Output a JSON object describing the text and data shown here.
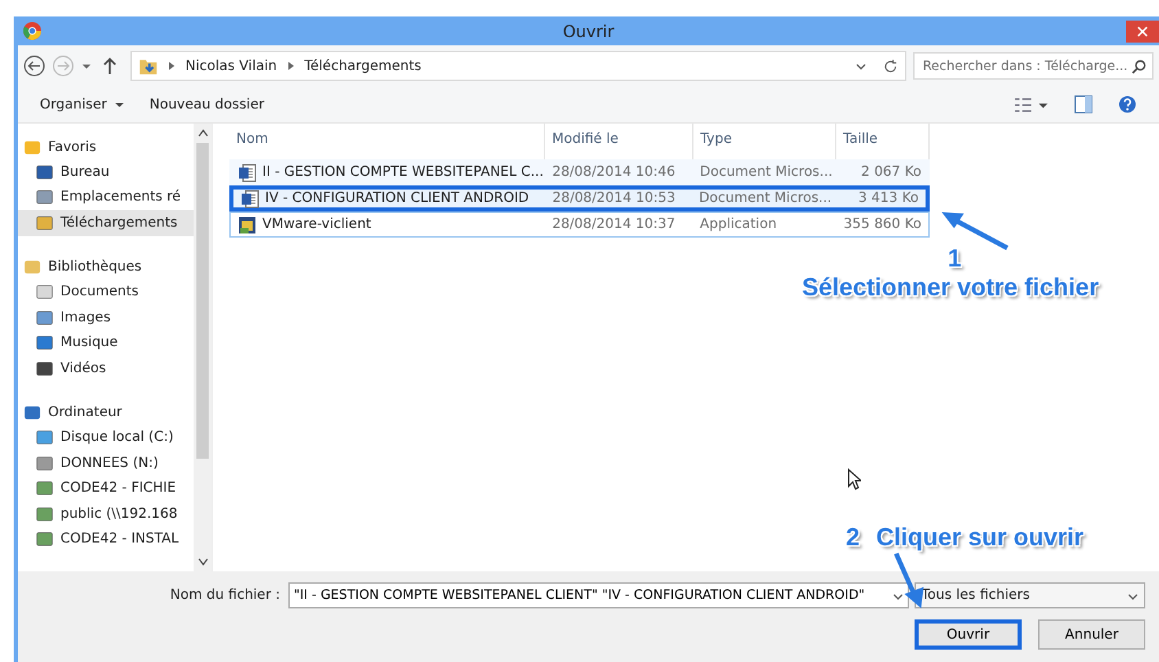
{
  "window": {
    "title": "Ouvrir"
  },
  "address": {
    "path": [
      "Nicolas Vilain",
      "Téléchargements"
    ],
    "search_placeholder": "Rechercher dans : Télécharge..."
  },
  "toolbar": [
    "Organiser",
    "Nouveau dossier"
  ],
  "sidebar": [
    {
      "label": "Favoris",
      "children": [
        {
          "label": "Bureau",
          "selected": false
        },
        {
          "label": "Emplacements ré",
          "selected": false
        },
        {
          "label": "Téléchargements",
          "selected": true
        }
      ]
    },
    {
      "label": "Bibliothèques",
      "children": [
        {
          "label": "Documents",
          "selected": false
        },
        {
          "label": "Images",
          "selected": false
        },
        {
          "label": "Musique",
          "selected": false
        },
        {
          "label": "Vidéos",
          "selected": false
        }
      ]
    },
    {
      "label": "Ordinateur",
      "children": [
        {
          "label": "Disque local (C:)",
          "selected": false
        },
        {
          "label": "DONNEES (N:)",
          "selected": false
        },
        {
          "label": "CODE42 - FICHIE",
          "selected": false
        },
        {
          "label": "public (\\\\192.168",
          "selected": false
        },
        {
          "label": "CODE42 - INSTAL",
          "selected": false
        }
      ]
    }
  ],
  "table": {
    "columns": [
      "Nom",
      "Modifié le",
      "Type",
      "Taille"
    ],
    "rows": [
      {
        "kind": "word",
        "name": "II - GESTION COMPTE WEBSITEPANEL C...",
        "modified": "28/08/2014 10:46",
        "type": "Document Micros...",
        "size": "2 067 Ko",
        "selected": true,
        "focused": false,
        "annotated": false
      },
      {
        "kind": "word",
        "name": "IV - CONFIGURATION CLIENT ANDROID",
        "modified": "28/08/2014 10:53",
        "type": "Document Micros...",
        "size": "3 413 Ko",
        "selected": true,
        "focused": false,
        "annotated": true
      },
      {
        "kind": "app",
        "name": "VMware-viclient",
        "modified": "28/08/2014 10:37",
        "type": "Application",
        "size": "355 860 Ko",
        "selected": false,
        "focused": true,
        "annotated": false
      }
    ]
  },
  "footer": {
    "filename_label": "Nom du fichier :",
    "filename_value": "\"II - GESTION COMPTE WEBSITEPANEL CLIENT\" \"IV - CONFIGURATION CLIENT ANDROID\"",
    "filter": "Tous les fichiers",
    "buttons": [
      {
        "label": "Ouvrir",
        "annotated": true
      },
      {
        "label": "Annuler",
        "annotated": false
      }
    ]
  },
  "annotations": [
    {
      "number": "1",
      "text": "Sélectionner votre fichier"
    },
    {
      "number": "2",
      "text": "Cliquer sur ouvrir"
    }
  ]
}
